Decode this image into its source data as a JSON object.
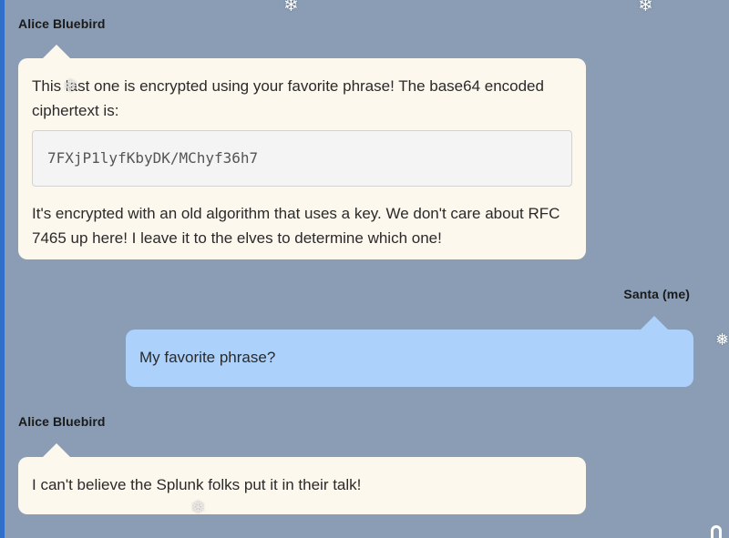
{
  "chat": {
    "messages": [
      {
        "sender": "Alice Bluebird",
        "direction": "incoming",
        "text_before": "This last one is encrypted using your favorite phrase! The base64 encoded ciphertext is:",
        "code": "7FXjP1lyfKbyDK/MChyf36h7",
        "text_after": "It's encrypted with an old algorithm that uses a key. We don't care about RFC 7465 up here! I leave it to the elves to determine which one!"
      },
      {
        "sender": "Santa (me)",
        "direction": "outgoing",
        "text": "My favorite phrase?"
      },
      {
        "sender": "Alice Bluebird",
        "direction": "incoming",
        "text": "I can't believe the Splunk folks put it in their talk!"
      }
    ]
  },
  "decor": {
    "snowflake_glyph": "❄",
    "snowflake_alt_glyph": "❅"
  },
  "colors": {
    "background": "#8a9db5",
    "incoming_bubble": "#fdf8ee",
    "outgoing_bubble": "#acd1fb",
    "code_box": "#f4f4f4",
    "left_accent": "#2f6fc9"
  },
  "icons": {
    "snowflake": "snowflake-icon",
    "scroll": "scroll-handle-icon"
  }
}
